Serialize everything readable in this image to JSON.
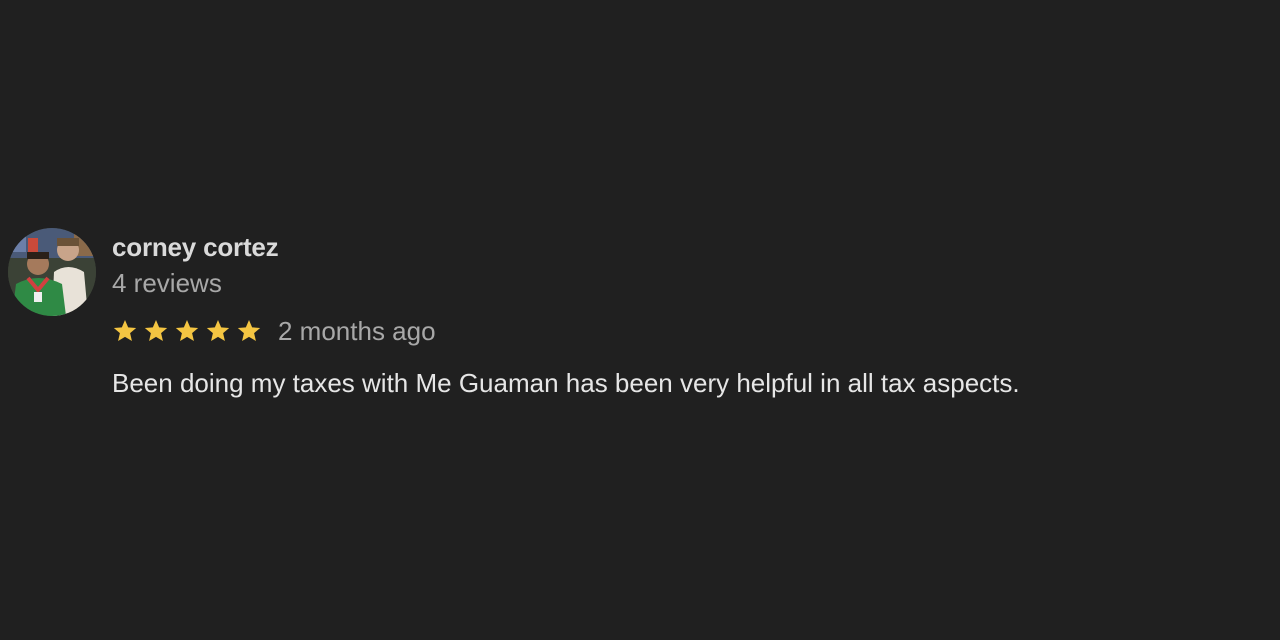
{
  "review": {
    "author_name": "corney cortez",
    "review_count": "4 reviews",
    "rating": 5,
    "rating_max": 5,
    "date": "2 months ago",
    "text": "Been doing my taxes with Me Guaman has been very helpful in all tax aspects."
  },
  "colors": {
    "background": "#202020",
    "star": "#f4c542"
  },
  "icons": {
    "star": "star-icon",
    "avatar": "profile-photo"
  }
}
